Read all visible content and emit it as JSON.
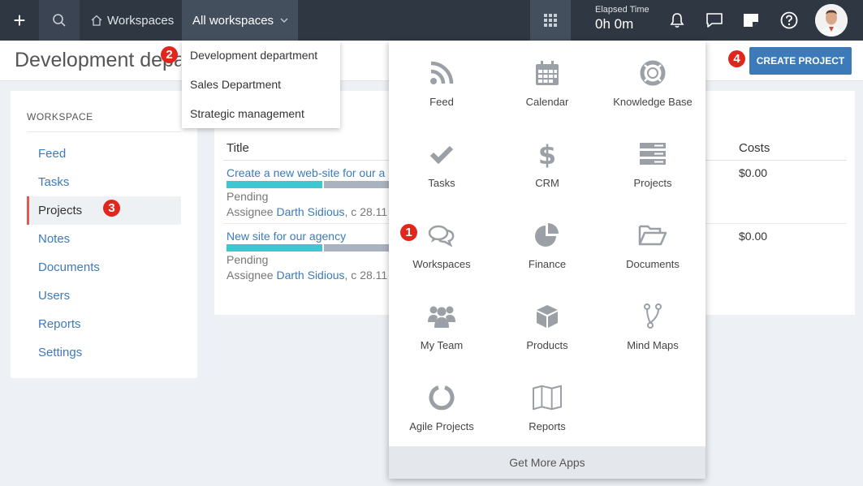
{
  "topbar": {
    "workspaces_label": "Workspaces",
    "all_workspaces_label": "All workspaces",
    "elapsed_label": "Elapsed Time",
    "elapsed_value": "0h 0m"
  },
  "header": {
    "title": "Development department",
    "create_button": "CREATE PROJECT"
  },
  "badges": [
    "1",
    "2",
    "3",
    "4"
  ],
  "workspace_dropdown": {
    "items": [
      "Development department",
      "Sales Department",
      "Strategic management"
    ]
  },
  "sidebar": {
    "title": "WORKSPACE",
    "items": [
      {
        "label": "Feed"
      },
      {
        "label": "Tasks"
      },
      {
        "label": "Projects"
      },
      {
        "label": "Notes"
      },
      {
        "label": "Documents"
      },
      {
        "label": "Users"
      },
      {
        "label": "Reports"
      },
      {
        "label": "Settings"
      }
    ]
  },
  "table": {
    "col_title": "Title",
    "col_costs": "Costs",
    "rows": [
      {
        "title": "Create a new web-site for our a",
        "progress": 0.6,
        "status": "Pending",
        "assignee_prefix": "Assignee",
        "assignee": "Darth Sidious",
        "date": ", c 28.11",
        "cost": "$0.00"
      },
      {
        "title": "New site for our agency",
        "progress": 0.6,
        "status": "Pending",
        "assignee_prefix": "Assignee",
        "assignee": "Darth Sidious",
        "date": ", c 28.11",
        "cost": "$0.00"
      }
    ]
  },
  "apps": {
    "items": [
      {
        "label": "Feed",
        "icon": "rss-icon"
      },
      {
        "label": "Calendar",
        "icon": "calendar-icon"
      },
      {
        "label": "Knowledge Base",
        "icon": "lifebuoy-icon"
      },
      {
        "label": "Tasks",
        "icon": "check-icon"
      },
      {
        "label": "CRM",
        "icon": "dollar-icon"
      },
      {
        "label": "Projects",
        "icon": "server-icon"
      },
      {
        "label": "Workspaces",
        "icon": "chat-bubbles-icon"
      },
      {
        "label": "Finance",
        "icon": "pie-chart-icon"
      },
      {
        "label": "Documents",
        "icon": "folder-open-icon"
      },
      {
        "label": "My Team",
        "icon": "team-icon"
      },
      {
        "label": "Products",
        "icon": "cube-icon"
      },
      {
        "label": "Mind Maps",
        "icon": "branch-icon"
      },
      {
        "label": "Agile Projects",
        "icon": "circle-ring-icon"
      },
      {
        "label": "Reports",
        "icon": "map-icon"
      }
    ],
    "footer": "Get More Apps"
  }
}
